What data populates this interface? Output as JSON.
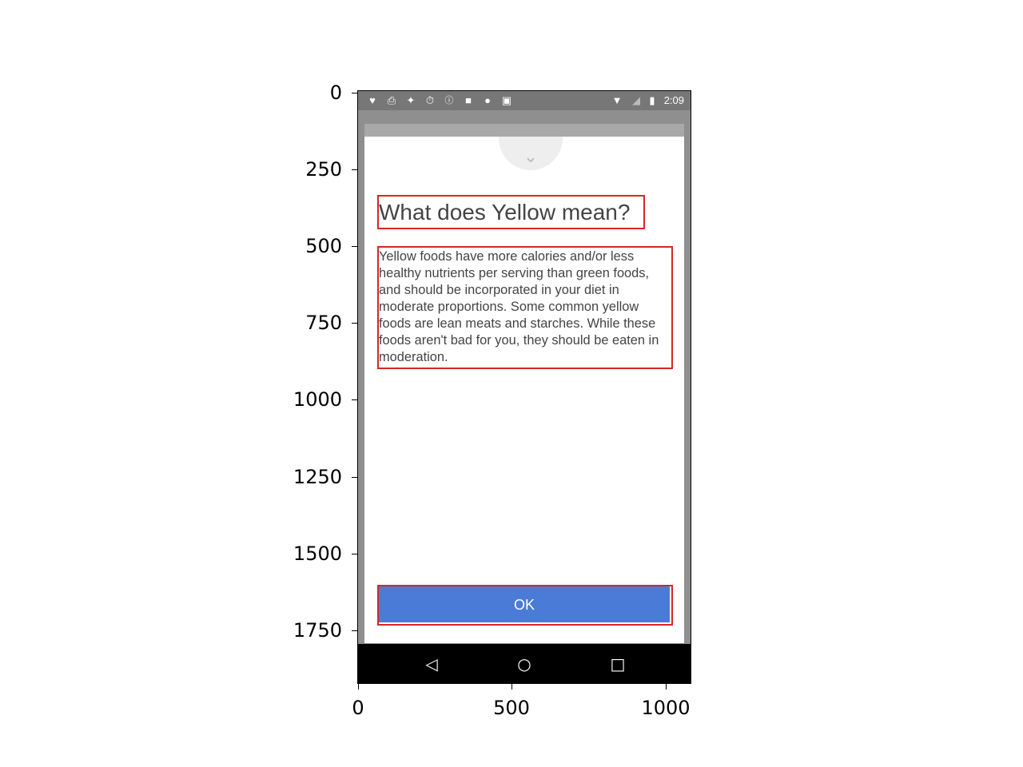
{
  "axes": {
    "y_ticks": [
      "0",
      "250",
      "500",
      "750",
      "1000",
      "1250",
      "1500",
      "1750"
    ],
    "x_ticks": [
      "0",
      "500",
      "1000"
    ]
  },
  "status_bar": {
    "time": "2:09",
    "left_icons": [
      "heart-icon",
      "download-icon",
      "pedometer-icon",
      "timer-icon",
      "info-icon",
      "lock-icon",
      "android-icon",
      "briefcase-icon"
    ],
    "right_icons": [
      "wifi-icon",
      "no-signal-icon",
      "battery-icon"
    ]
  },
  "dialog": {
    "title": "What does Yellow mean?",
    "body": "Yellow foods have more calories and/or less healthy nutrients per serving than green foods, and should be incorporated in your diet in moderate proportions. Some common yellow foods are lean meats and starches. While these foods aren't bad for you, they should be eaten in moderation.",
    "ok_label": "OK"
  },
  "nav_bar": {
    "back_icon": "back-triangle-icon",
    "home_icon": "home-circle-icon",
    "recents_icon": "recents-square-icon"
  },
  "colors": {
    "annotation_box": "#d62728",
    "ok_button": "#4a7bd6",
    "status_bar": "#777777",
    "scrim": "#8f8f8f"
  }
}
